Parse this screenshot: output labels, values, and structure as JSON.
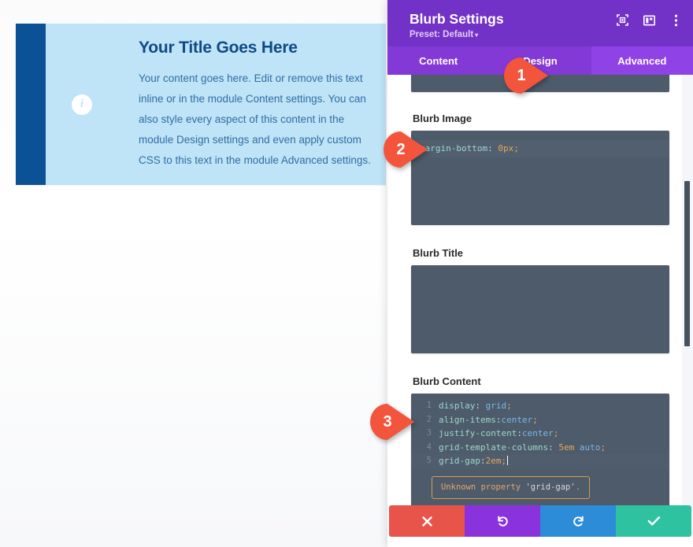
{
  "preview": {
    "blurb": {
      "icon": "info-icon",
      "title": "Your Title Goes Here",
      "description": "Your content goes here. Edit or remove this text inline or in the module Content settings. You can also style every aspect of this content in the module Design settings and even apply custom CSS to this text in the module Advanced settings."
    },
    "colors": {
      "blurb_background": "#bfe3f7",
      "blurb_accent": "#0b5196",
      "title_color": "#0e4a86",
      "text_color": "#2f6ea6"
    }
  },
  "panel": {
    "title": "Blurb Settings",
    "preset_label": "Preset: Default",
    "preset_caret": "▾",
    "header_icons": [
      {
        "name": "focus-mode-icon"
      },
      {
        "name": "layout-view-icon"
      },
      {
        "name": "more-options-icon"
      }
    ],
    "tabs": [
      {
        "label": "Content",
        "active": false
      },
      {
        "label": "Design",
        "active": false
      },
      {
        "label": "Advanced",
        "active": true
      }
    ],
    "colors": {
      "header_purple": "#7332c7",
      "tab_bar_purple": "#8239d6",
      "tab_active_purple": "#8f43e6",
      "code_background": "#4d5b6b"
    },
    "fields": [
      {
        "name": "main-element",
        "label": "",
        "partial": true,
        "lines": []
      },
      {
        "name": "blurb-image",
        "label": "Blurb Image",
        "single_line": true,
        "code": "margin-bottom: 0px;",
        "code_tokens": [
          {
            "t": "margin-bottom",
            "c": "prop"
          },
          {
            "t": ":",
            "c": "punct"
          },
          {
            "t": " 0px",
            "c": "num"
          },
          {
            "t": ";",
            "c": "semi"
          }
        ]
      },
      {
        "name": "blurb-title",
        "label": "Blurb Title",
        "empty": true,
        "code": ""
      },
      {
        "name": "blurb-content",
        "label": "Blurb Content",
        "lines": [
          {
            "n": "1",
            "tokens": [
              {
                "t": "display",
                "c": "prop"
              },
              {
                "t": ":",
                "c": "punct"
              },
              {
                "t": " grid",
                "c": "val"
              },
              {
                "t": ";",
                "c": "semi"
              }
            ]
          },
          {
            "n": "2",
            "tokens": [
              {
                "t": "align-items",
                "c": "prop"
              },
              {
                "t": ":",
                "c": "punct"
              },
              {
                "t": "center",
                "c": "val"
              },
              {
                "t": ";",
                "c": "semi"
              }
            ]
          },
          {
            "n": "3",
            "tokens": [
              {
                "t": "justify-content",
                "c": "prop"
              },
              {
                "t": ":",
                "c": "punct"
              },
              {
                "t": "center",
                "c": "val"
              },
              {
                "t": ";",
                "c": "semi"
              }
            ]
          },
          {
            "n": "4",
            "tokens": [
              {
                "t": "grid-template-columns",
                "c": "prop"
              },
              {
                "t": ":",
                "c": "punct"
              },
              {
                "t": " 5em",
                "c": "num"
              },
              {
                "t": " auto",
                "c": "val"
              },
              {
                "t": ";",
                "c": "semi"
              }
            ]
          },
          {
            "n": "5",
            "active": true,
            "tokens": [
              {
                "t": "grid-gap",
                "c": "prop"
              },
              {
                "t": ":",
                "c": "punct"
              },
              {
                "t": "2em",
                "c": "num"
              },
              {
                "t": ";",
                "c": "semi"
              }
            ]
          }
        ],
        "error": {
          "prefix": "Unknown property ",
          "quoted": "'grid-gap'",
          "suffix": "."
        }
      }
    ],
    "actions": [
      {
        "name": "cancel-button",
        "icon": "close-icon",
        "color": "#e8544a"
      },
      {
        "name": "undo-button",
        "icon": "undo-icon",
        "color": "#8a33dd"
      },
      {
        "name": "redo-button",
        "icon": "redo-icon",
        "color": "#2d8cd8"
      },
      {
        "name": "save-button",
        "icon": "check-icon",
        "color": "#2ec2a0"
      }
    ],
    "scrollbar": {
      "name": "panel-scrollbar"
    }
  },
  "callouts": [
    {
      "number": "1",
      "target": "advanced-tab"
    },
    {
      "number": "2",
      "target": "blurb-image-code"
    },
    {
      "number": "3",
      "target": "blurb-content-code"
    }
  ]
}
